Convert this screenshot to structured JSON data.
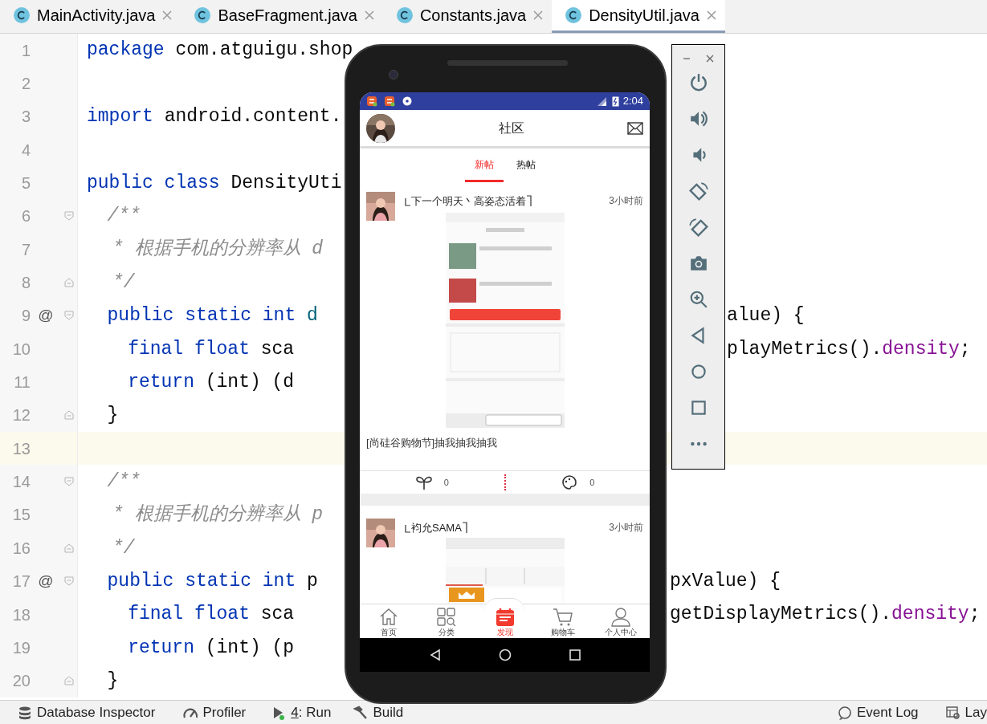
{
  "editor_tabs": [
    {
      "label": "MainActivity.java",
      "selected": false
    },
    {
      "label": "BaseFragment.java",
      "selected": false
    },
    {
      "label": "Constants.java",
      "selected": false
    },
    {
      "label": "DensityUtil.java",
      "selected": true
    }
  ],
  "editor": {
    "lines": [
      {
        "number": "1",
        "highlighted": false,
        "fold_start": false,
        "fold_end": false,
        "left": [
          {
            "kind": "keyword",
            "text": "package"
          },
          {
            "kind": "plain",
            "text": " com.atguigu.shop"
          }
        ]
      },
      {
        "number": "2",
        "highlighted": false,
        "fold_start": false,
        "fold_end": false
      },
      {
        "number": "3",
        "highlighted": false,
        "fold_start": false,
        "fold_end": false,
        "left": [
          {
            "kind": "keyword",
            "text": "import"
          },
          {
            "kind": "plain",
            "text": " android.content."
          }
        ]
      },
      {
        "number": "4",
        "highlighted": false,
        "fold_start": false,
        "fold_end": false
      },
      {
        "number": "5",
        "highlighted": false,
        "fold_start": false,
        "fold_end": false,
        "left": [
          {
            "kind": "keyword",
            "text": "public class"
          },
          {
            "kind": "plain",
            "text": " DensityUti"
          }
        ]
      },
      {
        "number": "6",
        "highlighted": false,
        "fold_start": true,
        "fold_end": false,
        "left": [
          {
            "kind": "comment",
            "text": "    /**"
          }
        ]
      },
      {
        "number": "7",
        "highlighted": false,
        "fold_start": false,
        "fold_end": false,
        "left": [
          {
            "kind": "comment",
            "text": "     * 根据手机的分辨率从 d"
          }
        ]
      },
      {
        "number": "8",
        "highlighted": false,
        "fold_start": false,
        "fold_end": true,
        "left": [
          {
            "kind": "comment",
            "text": "     */"
          }
        ]
      },
      {
        "number": "9",
        "highlighted": false,
        "marker": "@",
        "fold_start": true,
        "fold_end": false,
        "left": [
          {
            "kind": "keyword",
            "text": "    public static int"
          },
          {
            "kind": "method",
            "text": " d"
          }
        ],
        "right": [
          {
            "kind": "plain",
            "text": "alue) {"
          }
        ]
      },
      {
        "number": "10",
        "highlighted": false,
        "fold_start": false,
        "fold_end": false,
        "left": [
          {
            "kind": "keyword",
            "text": "        final float"
          },
          {
            "kind": "plain",
            "text": " sca"
          }
        ],
        "right": [
          {
            "kind": "plain",
            "text": "playMetrics()."
          },
          {
            "kind": "field",
            "text": "density"
          },
          {
            "kind": "plain",
            "text": ";"
          }
        ]
      },
      {
        "number": "11",
        "highlighted": false,
        "fold_start": false,
        "fold_end": false,
        "left": [
          {
            "kind": "keyword",
            "text": "        return"
          },
          {
            "kind": "plain",
            "text": " (int) (d"
          }
        ]
      },
      {
        "number": "12",
        "highlighted": false,
        "fold_start": false,
        "fold_end": true,
        "left": [
          {
            "kind": "plain",
            "text": "    }"
          }
        ]
      },
      {
        "number": "13",
        "highlighted": true,
        "fold_start": false,
        "fold_end": false
      },
      {
        "number": "14",
        "highlighted": false,
        "fold_start": true,
        "fold_end": false,
        "left": [
          {
            "kind": "comment",
            "text": "    /**"
          }
        ]
      },
      {
        "number": "15",
        "highlighted": false,
        "fold_start": false,
        "fold_end": false,
        "left": [
          {
            "kind": "comment",
            "text": "     * 根据手机的分辨率从 p"
          }
        ]
      },
      {
        "number": "16",
        "highlighted": false,
        "fold_start": false,
        "fold_end": true,
        "left": [
          {
            "kind": "comment",
            "text": "     */"
          }
        ]
      },
      {
        "number": "17",
        "highlighted": false,
        "marker": "@",
        "fold_start": true,
        "fold_end": false,
        "left": [
          {
            "kind": "keyword",
            "text": "    public static int"
          },
          {
            "kind": "plain",
            "text": " p"
          }
        ],
        "right": [
          {
            "kind": "plain",
            "text": "pxValue) {"
          }
        ]
      },
      {
        "number": "18",
        "highlighted": false,
        "fold_start": false,
        "fold_end": false,
        "left": [
          {
            "kind": "keyword",
            "text": "        final float"
          },
          {
            "kind": "plain",
            "text": " sca"
          }
        ],
        "right": [
          {
            "kind": "plain",
            "text": "getDisplayMetrics()."
          },
          {
            "kind": "field",
            "text": "density"
          },
          {
            "kind": "plain",
            "text": ";"
          }
        ]
      },
      {
        "number": "19",
        "highlighted": false,
        "fold_start": false,
        "fold_end": false,
        "left": [
          {
            "kind": "keyword",
            "text": "        return"
          },
          {
            "kind": "plain",
            "text": " (int) (p"
          }
        ]
      },
      {
        "number": "20",
        "highlighted": false,
        "fold_start": false,
        "fold_end": true,
        "left": [
          {
            "kind": "plain",
            "text": "    }"
          }
        ]
      }
    ]
  },
  "emulator": {
    "status_bar": {
      "time": "2:04"
    },
    "header": {
      "title": "社区"
    },
    "tabs": [
      {
        "label": "新帖",
        "selected": true
      },
      {
        "label": "热帖",
        "selected": false
      }
    ],
    "posts": [
      {
        "author": "下一个明天丶高姿态活着",
        "time": "3小时前",
        "text": "[尚硅谷购物节]抽我抽我抽我",
        "likes": "0",
        "comments": "0"
      },
      {
        "author": "袀允SAMA",
        "time": "3小时前"
      }
    ],
    "bottom_nav": [
      {
        "label": "首页",
        "selected": false
      },
      {
        "label": "分类",
        "selected": false
      },
      {
        "label": "发现",
        "selected": true
      },
      {
        "label": "购物车",
        "selected": false
      },
      {
        "label": "个人中心",
        "selected": false
      }
    ]
  },
  "status_bar": {
    "left": [
      {
        "label": "Database Inspector",
        "underline_first": false
      },
      {
        "label": "Profiler",
        "underline_first": false
      },
      {
        "label": "4: Run",
        "underline_first": true
      },
      {
        "label": "Build",
        "underline_first": false
      }
    ],
    "right": [
      {
        "label": "Event Log",
        "underline_first": false
      },
      {
        "label": "Lay",
        "underline_first": false
      }
    ]
  }
}
